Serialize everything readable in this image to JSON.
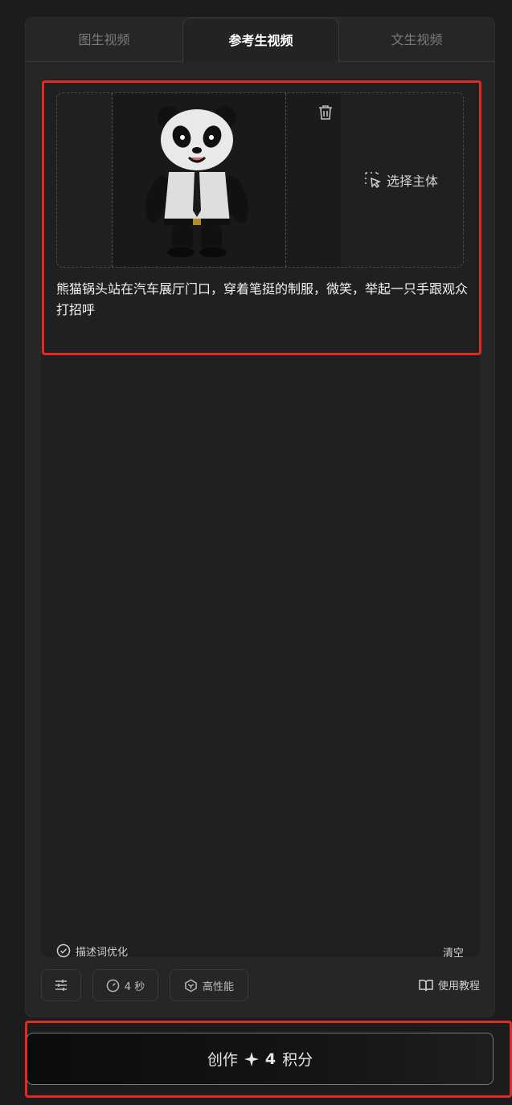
{
  "tabs": [
    {
      "label": "图生视频"
    },
    {
      "label": "参考生视频"
    },
    {
      "label": "文生视频"
    }
  ],
  "upload": {
    "select_subject_label": "选择主体"
  },
  "prompt": {
    "text": "熊猫锅头站在汽车展厅门口，穿着笔挺的制服，微笑，举起一只手跟观众打招呼"
  },
  "footer": {
    "optimize_label": "描述词优化",
    "clear_label": "清空"
  },
  "toolbar": {
    "duration_label": "4 秒",
    "mode_label": "高性能",
    "tutorial_label": "使用教程"
  },
  "create_button": {
    "label": "创作",
    "cost_value": "4",
    "cost_unit": "积分"
  },
  "colors": {
    "highlight": "#e02a24",
    "panel": "#262626",
    "background": "#1c1c1c"
  }
}
